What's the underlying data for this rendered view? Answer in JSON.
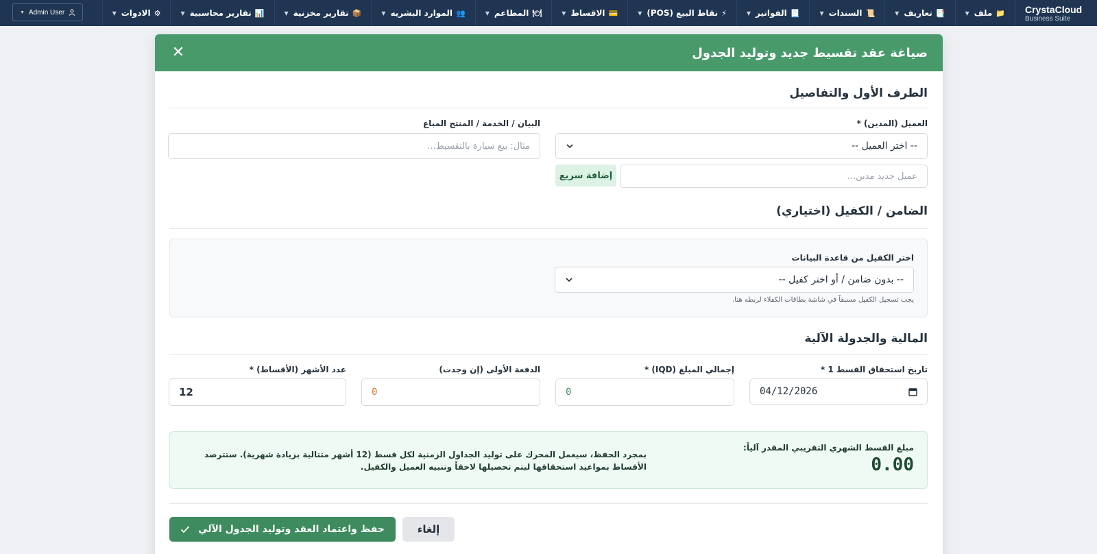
{
  "app": {
    "brand": "CrystaCloud",
    "brand_sub": "Business Suite"
  },
  "nav": {
    "items": [
      {
        "icon": "📁",
        "label": "ملف"
      },
      {
        "icon": "📑",
        "label": "تعاريف"
      },
      {
        "icon": "📜",
        "label": "السندات"
      },
      {
        "icon": "📃",
        "label": "الفواتير"
      },
      {
        "icon": "⚡",
        "label": "نقاط البيع (POS)"
      },
      {
        "icon": "💳",
        "label": "الاقساط"
      },
      {
        "icon": "🍽",
        "label": "المطاعم"
      },
      {
        "icon": "👥",
        "label": "الموارد البشريه"
      },
      {
        "icon": "📦",
        "label": "تقارير مخزنية"
      },
      {
        "icon": "📊",
        "label": "تقارير محاسبية"
      },
      {
        "icon": "⚙",
        "label": "الادوات"
      }
    ],
    "user": "Admin User"
  },
  "modal": {
    "title": "صياغة عقد تقسيط جديد وتوليد الجدول",
    "section1": {
      "title": "الطرف الأول والتفاصيل",
      "customer_label": "العميل (المدين) *",
      "customer_value": "-- اختر العميل --",
      "new_customer_placeholder": "عميل جديد مدين...",
      "quick_add": "إضافة سريع",
      "description_label": "البيان / الخدمة / المنتج المباع",
      "description_placeholder": "مثال: بيع سيارة بالتقسيط..."
    },
    "section2": {
      "title": "الضامن / الكفيل (اختياري)",
      "guarantor_label": "اختر الكفيل من قاعدة البيانات",
      "guarantor_value": "-- بدون ضامن / أو اختر كفيل --",
      "hint": "يجب تسجيل الكفيل مسبقاً في شاشة بطاقات الكفلاء لربطه هنا."
    },
    "section3": {
      "title": "المالية والجدولة الآلية",
      "first_due_label": "تاريخ استحقاق القسط 1 *",
      "first_due_value": "04/12/2026",
      "total_label": "إجمالي المبلغ (IQD) *",
      "total_value": "0",
      "down_payment_label": "الدفعة الأولى (إن وجدت)",
      "down_payment_value": "0",
      "months_label": "عدد الأشهر (الأقساط) *",
      "months_value": "12",
      "colors": {
        "total": "#3e8b5f",
        "down_payment": "#d9772b"
      }
    },
    "summary": {
      "label": "مبلغ القسط الشهري التقريبي المقدر آلياً:",
      "value": "0.00",
      "note": "بمجرد الحفظ، سيعمل المحرك على توليد الجداول الزمنية لكل قسط (12 أشهر متتالية بزيادة شهرية). ستترصد الأقساط بمواعيد استحقاقها ليتم تحصيلها لاحقاً وتنبيه العميل والكفيل."
    },
    "actions": {
      "cancel": "إلغاء",
      "save": "حفظ واعتماد العقد وتوليد الجدول الآلي"
    }
  }
}
